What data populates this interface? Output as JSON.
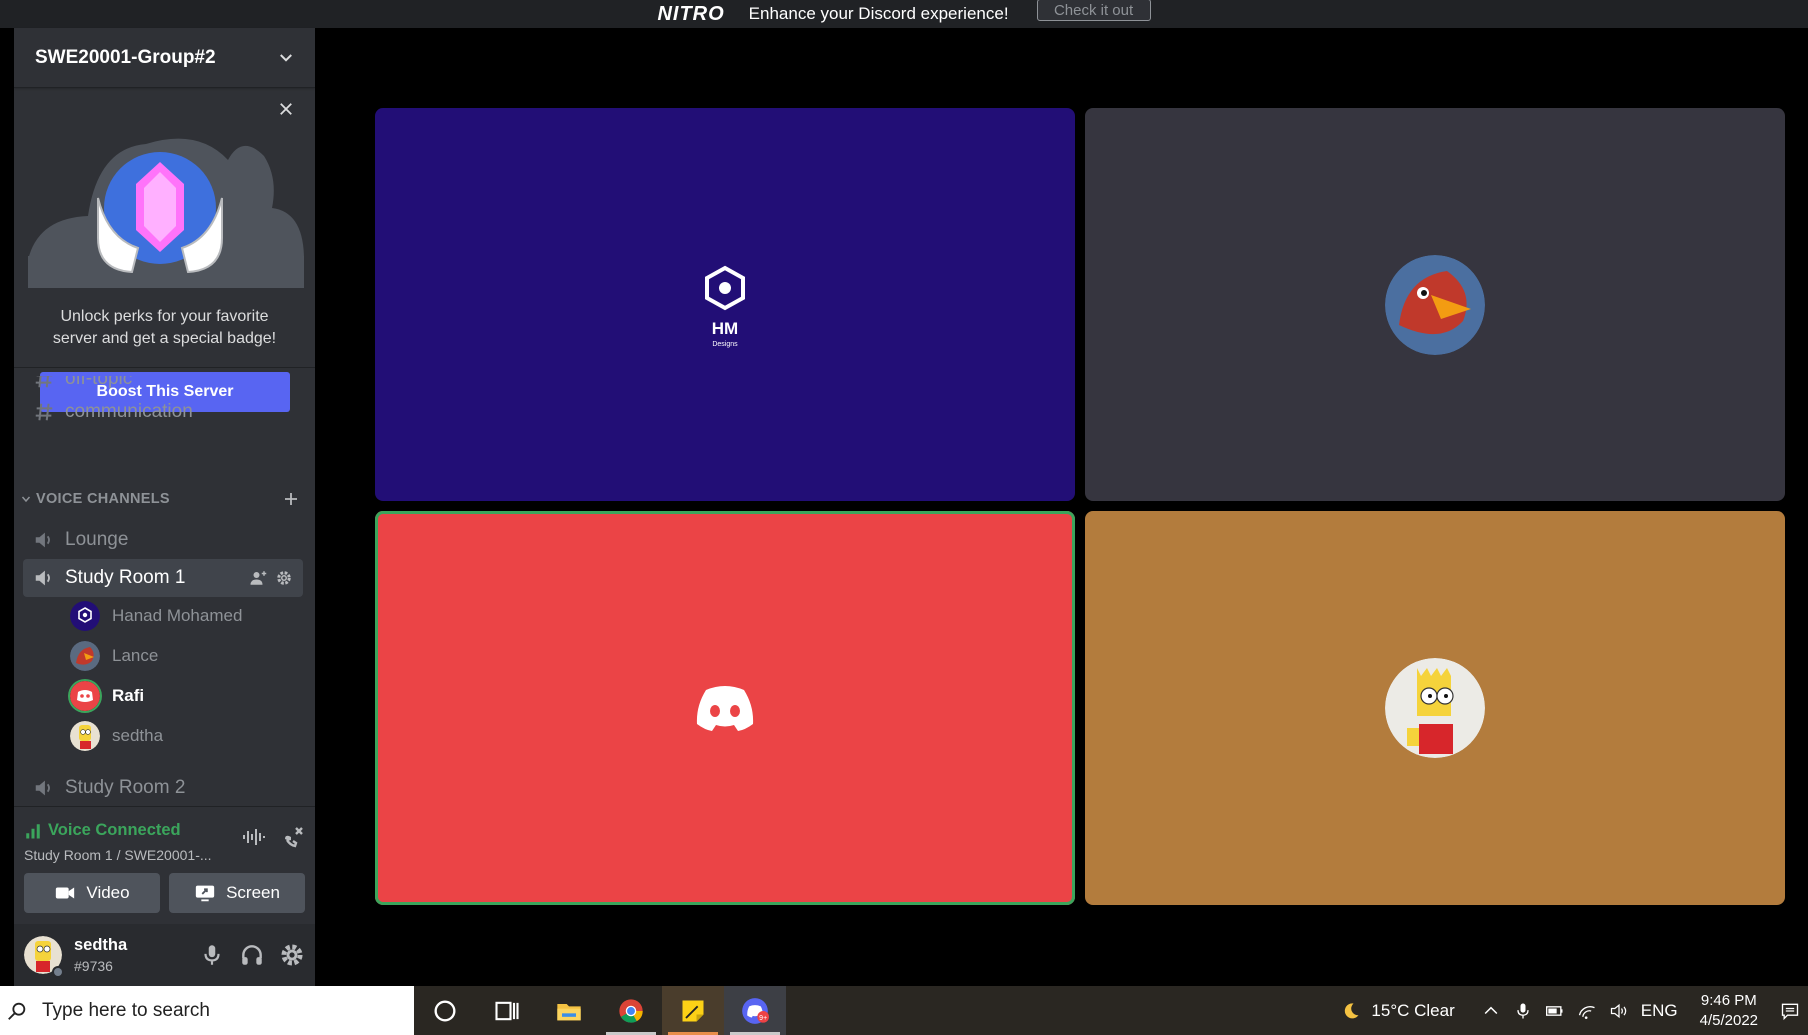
{
  "banner": {
    "brand": "NITRO",
    "message": "Enhance your Discord experience!",
    "cta": "Check it out"
  },
  "server": {
    "name": "SWE20001-Group#2"
  },
  "boost": {
    "text_line1": "Unlock perks for your favorite",
    "text_line2": "server and get a special badge!",
    "button": "Boost This Server"
  },
  "channels": {
    "text_partial": "off-topic",
    "text": "communication",
    "voice_category": "VOICE CHANNELS",
    "voice": [
      {
        "label": "Lounge"
      },
      {
        "label": "Study Room 1"
      },
      {
        "label": "Study Room 2"
      }
    ],
    "members": [
      {
        "name": "Hanad Mohamed"
      },
      {
        "name": "Lance"
      },
      {
        "name": "Rafi"
      },
      {
        "name": "sedtha"
      }
    ]
  },
  "voice_status": {
    "title": "Voice Connected",
    "location": "Study Room 1 / SWE20001-...",
    "video_button": "Video",
    "screen_button": "Screen"
  },
  "user": {
    "name": "sedtha",
    "tag": "#9736"
  },
  "tiles": {
    "hm_logo_text": "HM",
    "hm_logo_sub": "Designs"
  },
  "colors": {
    "blurple": "#5865f2",
    "green": "#3ba55c",
    "tile_hanad": "#220e76",
    "tile_lance": "#36353f",
    "tile_rafi": "#eb4446",
    "tile_sedtha": "#b37c3d"
  },
  "taskbar": {
    "search_placeholder": "Type here to search",
    "weather": "15°C  Clear",
    "language": "ENG",
    "time": "9:46 PM",
    "date": "4/5/2022"
  }
}
